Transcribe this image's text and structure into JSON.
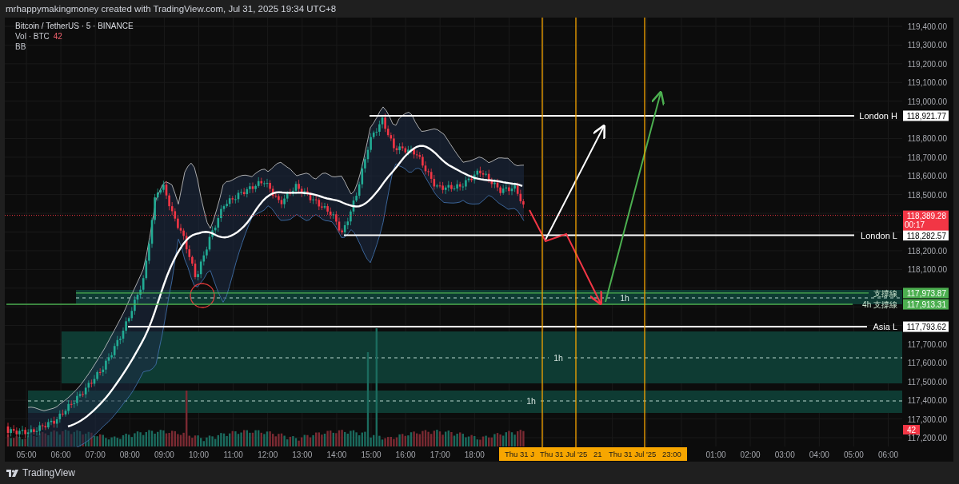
{
  "header": {
    "caption": "mrhappymakingmoney created with TradingView.com, Jul 31, 2025 19:34 UTC+8"
  },
  "legend": [
    {
      "kind": "symbol",
      "text": "Bitcoin / TetherUS · 5 · BINANCE"
    },
    {
      "kind": "volume",
      "text": "Vol · BTC",
      "value": "42"
    },
    {
      "kind": "indicator",
      "text": "BB"
    }
  ],
  "price_axis": {
    "ticks": [
      "119,400.00",
      "119,300.00",
      "119,200.00",
      "119,100.00",
      "119,000.00",
      "118,800.00",
      "118,700.00",
      "118,600.00",
      "118,500.00",
      "118,200.00",
      "118,100.00",
      "117,700.00",
      "117,600.00",
      "117,500.00",
      "117,400.00",
      "117,300.00",
      "117,200.00"
    ]
  },
  "levels": [
    {
      "kind": "session",
      "label": "London H",
      "price": "118,921.77"
    },
    {
      "kind": "session",
      "label": "London L",
      "price": "118,282.57"
    },
    {
      "kind": "support",
      "label": "支撐線",
      "price": "117,973.87"
    },
    {
      "kind": "support",
      "label": "4h 支撐線",
      "price": "117,913.31"
    },
    {
      "kind": "session",
      "label": "Asia L",
      "price": "117,793.62"
    }
  ],
  "zones": [
    {
      "label": "1h"
    },
    {
      "label": "1h"
    },
    {
      "label": "1h"
    }
  ],
  "last_price": {
    "price": "118,389.28",
    "countdown": "00:17"
  },
  "volume_tag": "42",
  "time_axis": {
    "ticks": [
      "05:00",
      "06:00",
      "07:00",
      "08:00",
      "09:00",
      "10:00",
      "11:00",
      "12:00",
      "13:00",
      "14:00",
      "15:00",
      "16:00",
      "17:00",
      "18:00",
      "01:00",
      "02:00",
      "03:00",
      "04:00",
      "05:00",
      "06:00"
    ],
    "marker_labels": [
      "Thu 31 J",
      "Thu 31 Jul '25",
      "21",
      "Thu 31 Jul '25",
      "23:00"
    ]
  },
  "footer": {
    "brand": "TradingView"
  }
}
